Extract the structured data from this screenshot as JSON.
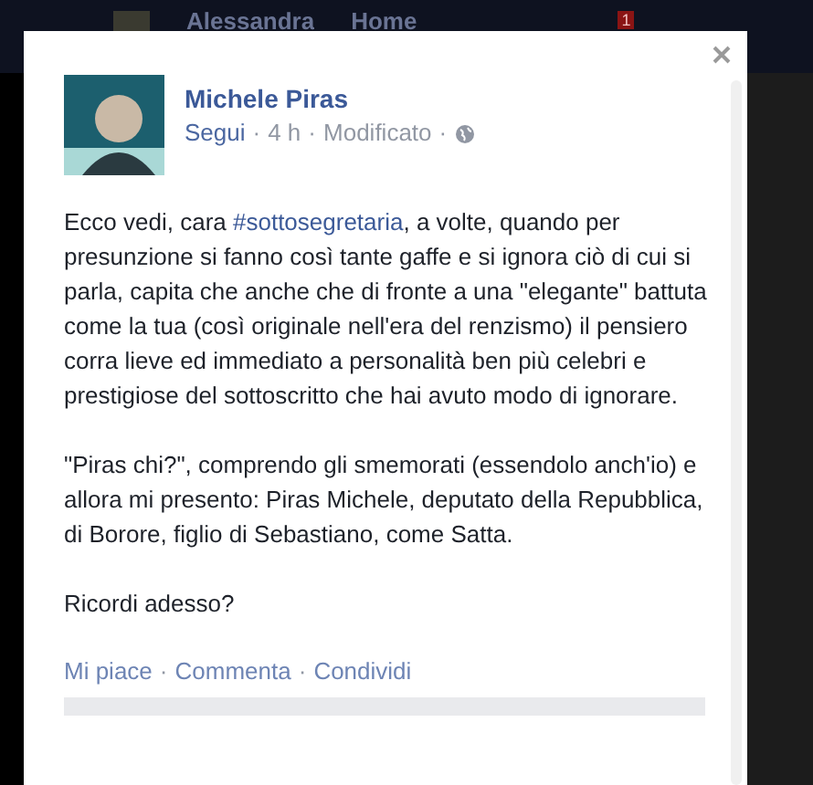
{
  "top_nav": {
    "profile_name": "Alessandra",
    "home": "Home",
    "notification_count": "1"
  },
  "post": {
    "author": "Michele Piras",
    "meta": [
      {
        "kind": "follow",
        "text": "Segui"
      },
      {
        "kind": "separator",
        "text": "·"
      },
      {
        "kind": "time",
        "text": "4 h"
      },
      {
        "kind": "separator",
        "text": "·"
      },
      {
        "kind": "edited",
        "text": "Modificato"
      },
      {
        "kind": "separator",
        "text": "·"
      }
    ],
    "paragraphs": [
      [
        {
          "kind": "text",
          "text": "Ecco vedi, cara "
        },
        {
          "kind": "hashtag",
          "text": "#sottosegretaria"
        },
        {
          "kind": "text",
          "text": ", a volte, quando per presunzione si fanno così tante gaffe e si ignora ciò di cui si parla, capita che anche che di fronte a una \"elegante\" battuta come la tua (così originale nell'era del renzismo) il pensiero corra lieve ed immediato a personalità ben più celebri e prestigiose del sottoscritto che hai avuto modo di ignorare."
        }
      ],
      [
        {
          "kind": "text",
          "text": "\"Piras chi?\", comprendo gli smemorati (essendolo anch'io) e allora mi presento: Piras Michele, deputato della Repubblica, di Borore, figlio di Sebastiano, come Satta."
        }
      ],
      [
        {
          "kind": "text",
          "text": "Ricordi adesso?"
        }
      ]
    ],
    "actions": [
      {
        "kind": "link",
        "text": "Mi piace"
      },
      {
        "kind": "separator",
        "text": "·"
      },
      {
        "kind": "link",
        "text": "Commenta"
      },
      {
        "kind": "separator",
        "text": "·"
      },
      {
        "kind": "link",
        "text": "Condividi"
      }
    ]
  }
}
